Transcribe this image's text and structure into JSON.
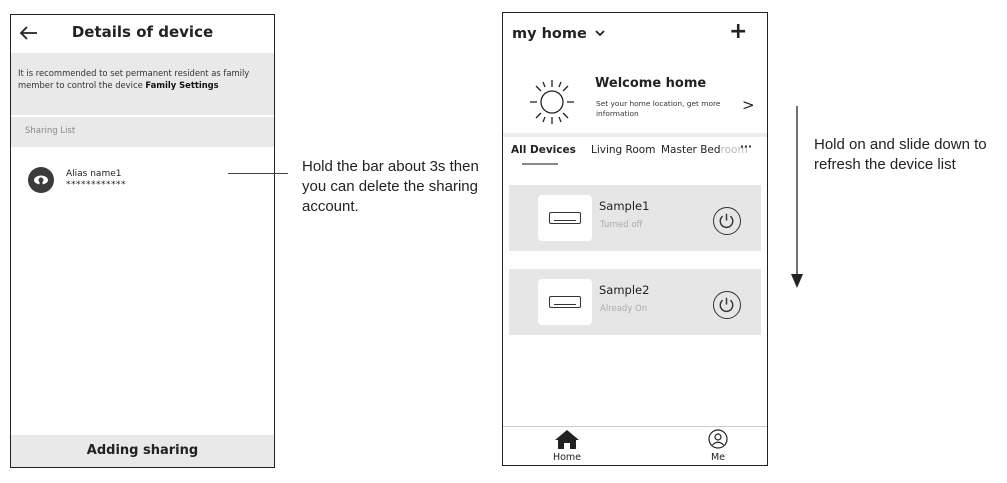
{
  "left_phone": {
    "title": "Details of device",
    "notice_text": "It is recommended to set permanent resident as family member to control the device ",
    "notice_link": "Family Settings",
    "sharing_header": "Sharing List",
    "sharing_item": {
      "alias": "Alias name1",
      "masked": "************"
    },
    "bottom_button": "Adding sharing",
    "icons": {
      "back": "arrow-left-icon",
      "avatar": "user-avatar-icon"
    }
  },
  "callout_text": "Hold the bar about 3s then you can delete the sharing account.",
  "right_phone": {
    "home_title": "my home",
    "home_dropdown_icon": "chevron-down-icon",
    "add_icon": "+",
    "welcome": {
      "title": "Welcome home",
      "subtitle": "Set your home location, get more information",
      "arrow": ">"
    },
    "tabs": [
      {
        "label": "All Devices",
        "active": true
      },
      {
        "label": "Living Room",
        "active": false
      },
      {
        "label": "Master Bed",
        "fade": "room",
        "active": false
      }
    ],
    "more_icon": "···",
    "devices": [
      {
        "name": "Sample1",
        "status": "Turned off"
      },
      {
        "name": "Sample2",
        "status": "Already On"
      }
    ],
    "nav": [
      {
        "label": "Home",
        "icon": "home-icon"
      },
      {
        "label": "Me",
        "icon": "profile-icon"
      }
    ]
  },
  "refresh_text": "Hold on and slide down to refresh the device list"
}
